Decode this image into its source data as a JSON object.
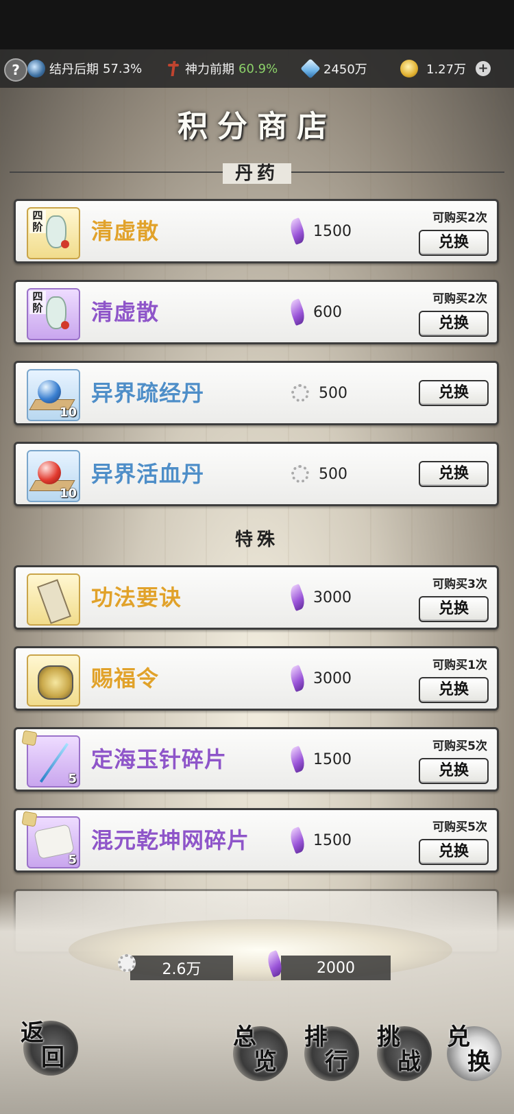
{
  "status": {
    "help": "?",
    "cultivation": {
      "label": "结丹后期",
      "value": "57.3%"
    },
    "divine": {
      "label": "神力前期",
      "value": "60.9%"
    },
    "crystal": "2450万",
    "gold": "1.27万",
    "plus": "+"
  },
  "title": "积分商店",
  "sections": [
    {
      "label": "丹药"
    },
    {
      "label": "特殊"
    }
  ],
  "items": [
    {
      "name": "清虚散",
      "tier": "四阶",
      "price": "1500",
      "currency": "feather-icon",
      "limit": "可购买2次",
      "button": "兑换",
      "rarity": "gold"
    },
    {
      "name": "清虚散",
      "tier": "四阶",
      "price": "600",
      "currency": "feather-icon",
      "limit": "可购买2次",
      "button": "兑换",
      "rarity": "purple"
    },
    {
      "name": "异界疏经丹",
      "qty": "10",
      "price": "500",
      "currency": "coin-icon",
      "button": "兑换",
      "rarity": "blue"
    },
    {
      "name": "异界活血丹",
      "qty": "10",
      "price": "500",
      "currency": "coin-icon",
      "button": "兑换",
      "rarity": "blue"
    },
    {
      "name": "功法要诀",
      "price": "3000",
      "currency": "feather-icon",
      "limit": "可购买3次",
      "button": "兑换",
      "rarity": "gold"
    },
    {
      "name": "赐福令",
      "price": "3000",
      "currency": "feather-icon",
      "limit": "可购买1次",
      "button": "兑换",
      "rarity": "gold"
    },
    {
      "name": "定海玉针碎片",
      "qty": "5",
      "price": "1500",
      "currency": "feather-icon",
      "limit": "可购买5次",
      "button": "兑换",
      "rarity": "purple"
    },
    {
      "name": "混元乾坤网碎片",
      "qty": "5",
      "price": "1500",
      "currency": "feather-icon",
      "limit": "可购买5次",
      "button": "兑换",
      "rarity": "purple"
    }
  ],
  "balances": {
    "coins": "2.6万",
    "feathers": "2000"
  },
  "nav": {
    "back": [
      "返",
      "回"
    ],
    "overview": [
      "总",
      "览"
    ],
    "rank": [
      "排",
      "行"
    ],
    "challenge": [
      "挑",
      "战"
    ],
    "exchange": [
      "兑",
      "换"
    ]
  },
  "colors": {
    "gold": "#e1a22a",
    "purple": "#8e55c9",
    "blue": "#4e8ec8",
    "green": "#8cd16a"
  }
}
